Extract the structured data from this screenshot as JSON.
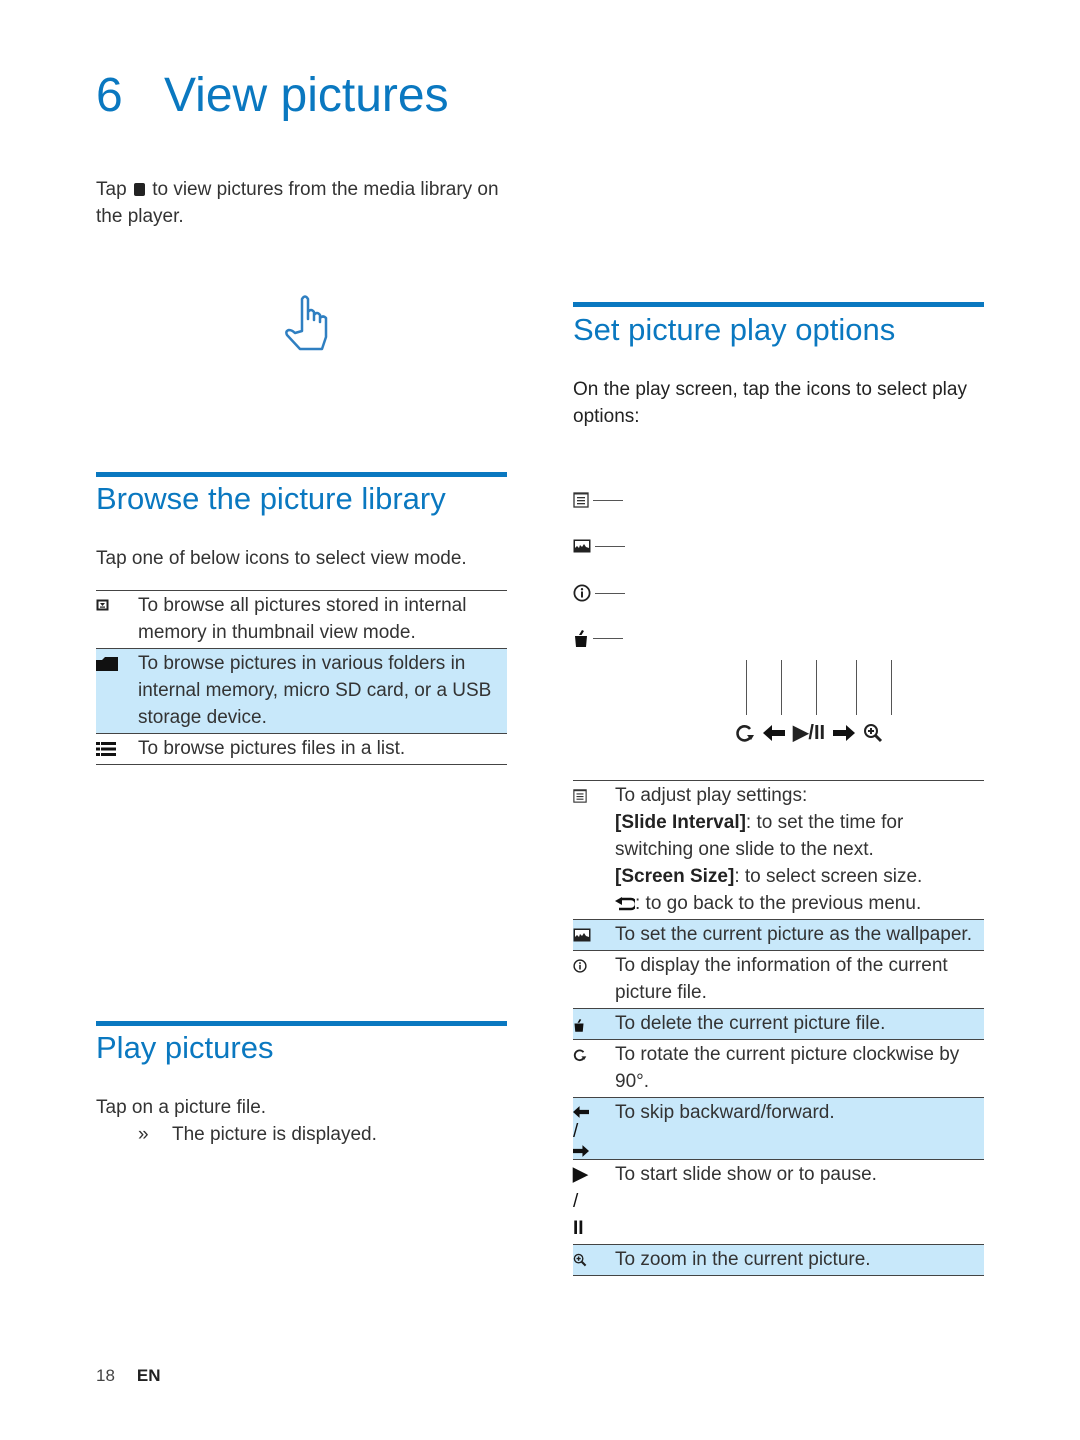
{
  "chapter": {
    "number": "6",
    "title": "View pictures"
  },
  "intro": {
    "before_icon": "Tap ",
    "after_icon": " to view pictures from the media library on the player.",
    "icon": "pictures-app-icon"
  },
  "browse": {
    "title": "Browse the picture library",
    "lead": "Tap one of below icons to select view mode.",
    "rows": [
      {
        "icon": "thumbnail-view-icon",
        "text": "To browse all pictures stored in internal memory in thumbnail view mode.",
        "highlight": false
      },
      {
        "icon": "folder-icon",
        "text": "To browse pictures in various folders in internal memory, micro SD card, or a USB storage device.",
        "highlight": true
      },
      {
        "icon": "list-icon",
        "text": "To browse pictures files in a list.",
        "highlight": false
      }
    ]
  },
  "play": {
    "title": "Play pictures",
    "step": "Tap on a picture file.",
    "result_marker": "»",
    "result": "The picture is displayed."
  },
  "options": {
    "title": "Set picture play options",
    "lead": "On the play screen, tap the icons to select play options:",
    "diagram_side_icons": [
      "settings-menu-icon",
      "wallpaper-icon",
      "info-icon",
      "delete-icon"
    ],
    "diagram_bottom_icons": [
      "rotate-icon",
      "skip-back-icon",
      "play-pause-icon",
      "skip-forward-icon",
      "zoom-in-icon"
    ],
    "play_pause_glyph": "▶/II",
    "rows": [
      {
        "icon": "settings-menu-icon",
        "highlight": false,
        "lines": [
          {
            "plain": "To adjust play settings:"
          },
          {
            "bold": "[Slide Interval]",
            "plain": ": to set the time for switching one slide to the next."
          },
          {
            "bold": "[Screen Size]",
            "plain": ": to select screen size."
          },
          {
            "icon": "back-icon",
            "plain": " : to go back to the previous menu."
          }
        ]
      },
      {
        "icon": "wallpaper-icon",
        "text": "To set the current picture as the wallpaper.",
        "highlight": true
      },
      {
        "icon": "info-icon",
        "text": "To display the information of the current picture file.",
        "highlight": false
      },
      {
        "icon": "delete-icon",
        "text": "To delete the current picture file.",
        "highlight": true
      },
      {
        "icon": "rotate-icon",
        "text": "To rotate the current picture clockwise by 90°.",
        "highlight": false
      },
      {
        "icon": "skip-icons",
        "icon_label": [
          "←",
          "/",
          "→"
        ],
        "text": "To skip backward/forward.",
        "highlight": true
      },
      {
        "icon": "play-pause-icons",
        "icon_label": [
          "▶",
          "/",
          "II"
        ],
        "text": "To start slide show or to pause.",
        "highlight": false
      },
      {
        "icon": "zoom-in-icon",
        "text": "To zoom in the current picture.",
        "highlight": true
      }
    ]
  },
  "footer": {
    "page": "18",
    "lang": "EN"
  },
  "colors": {
    "accent": "#0a78c0",
    "highlight": "#c8e8fa"
  }
}
